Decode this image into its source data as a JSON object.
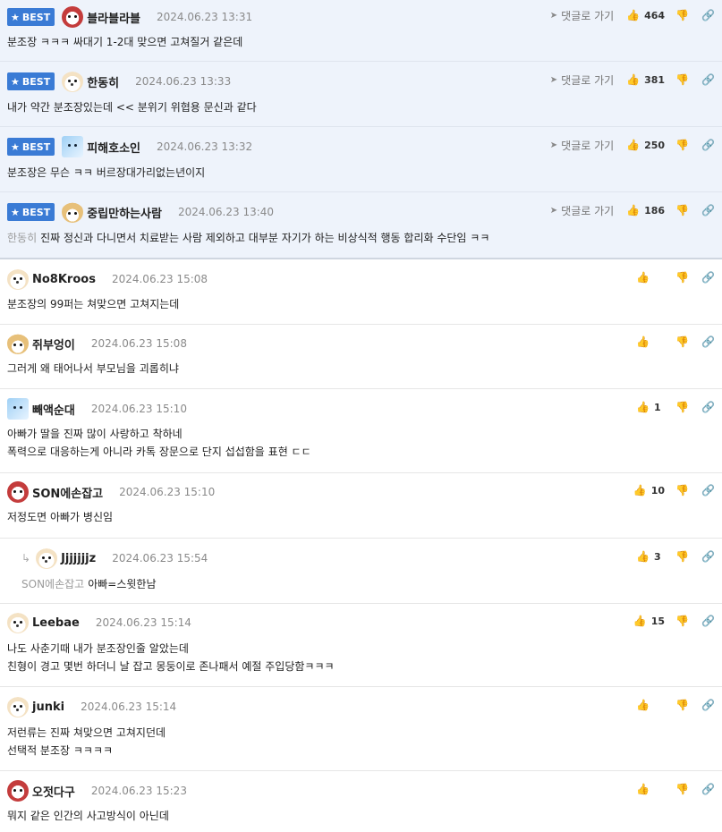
{
  "best_label": "BEST",
  "goto_label": "댓글로 가기",
  "best_comments": [
    {
      "nick": "블라블라블",
      "date": "2024.06.23 13:31",
      "likes": "464",
      "avatar": "red",
      "text": "분조장 ㅋㅋㅋ 싸대기 1-2대 맞으면 고쳐질거 같은데",
      "mention": ""
    },
    {
      "nick": "한동히",
      "date": "2024.06.23 13:33",
      "likes": "381",
      "avatar": "dog",
      "text": "내가 약간 분조장있는데 << 분위기 위협용 문신과 같다",
      "mention": ""
    },
    {
      "nick": "피해호소인",
      "date": "2024.06.23 13:32",
      "likes": "250",
      "avatar": "blue",
      "text": "분조장은 무슨 ㅋㅋ 버르장대가리없는년이지",
      "mention": ""
    },
    {
      "nick": "중립만하는사람",
      "date": "2024.06.23 13:40",
      "likes": "186",
      "avatar": "fox",
      "text": "진짜 정신과 다니면서 치료받는 사람 제외하고 대부분 자기가 하는 비상식적 행동 합리화 수단임 ㅋㅋ",
      "mention": "한동히"
    }
  ],
  "comments": [
    {
      "nick": "No8Kroos",
      "date": "2024.06.23 15:08",
      "likes": "",
      "avatar": "dog",
      "lines": [
        "분조장의 99퍼는 쳐맞으면 고쳐지는데"
      ],
      "mention": ""
    },
    {
      "nick": "쥐부엉이",
      "date": "2024.06.23 15:08",
      "likes": "",
      "avatar": "fox",
      "lines": [
        "그러게 왜 태어나서 부모님을 괴롭히냐"
      ],
      "mention": ""
    },
    {
      "nick": "빼액순대",
      "date": "2024.06.23 15:10",
      "likes": "1",
      "avatar": "blue",
      "lines": [
        "아빠가 딸을 진짜 많이 사랑하고 착하네",
        "폭력으로 대응하는게 아니라 카톡 장문으로 단지 섭섭함을 표현 ㄷㄷ"
      ],
      "mention": ""
    },
    {
      "nick": "SON에손잡고",
      "date": "2024.06.23 15:10",
      "likes": "10",
      "avatar": "red",
      "lines": [
        "저정도면 아빠가 병신임"
      ],
      "mention": ""
    },
    {
      "nick": "Jjjjjjjz",
      "date": "2024.06.23 15:54",
      "likes": "3",
      "avatar": "dog",
      "lines": [
        "아빠=스윗한남"
      ],
      "mention": "SON에손잡고",
      "reply": true
    },
    {
      "nick": "Leebae",
      "date": "2024.06.23 15:14",
      "likes": "15",
      "avatar": "dog",
      "lines": [
        "나도 사춘기때 내가 분조장인줄 알았는데",
        "친형이 경고 몇번 하더니 날 잡고 몽둥이로 존나패서 예절 주입당함ㅋㅋㅋ"
      ],
      "mention": ""
    },
    {
      "nick": "junki",
      "date": "2024.06.23 15:14",
      "likes": "",
      "avatar": "dog",
      "lines": [
        "저런류는 진짜 쳐맞으면 고쳐지던데",
        "선택적 분조장 ㅋㅋㅋㅋ"
      ],
      "mention": ""
    },
    {
      "nick": "오젓다구",
      "date": "2024.06.23 15:23",
      "likes": "",
      "avatar": "red",
      "lines": [
        "뭐지 같은 인간의 사고방식이 아닌데"
      ],
      "mention": ""
    }
  ]
}
